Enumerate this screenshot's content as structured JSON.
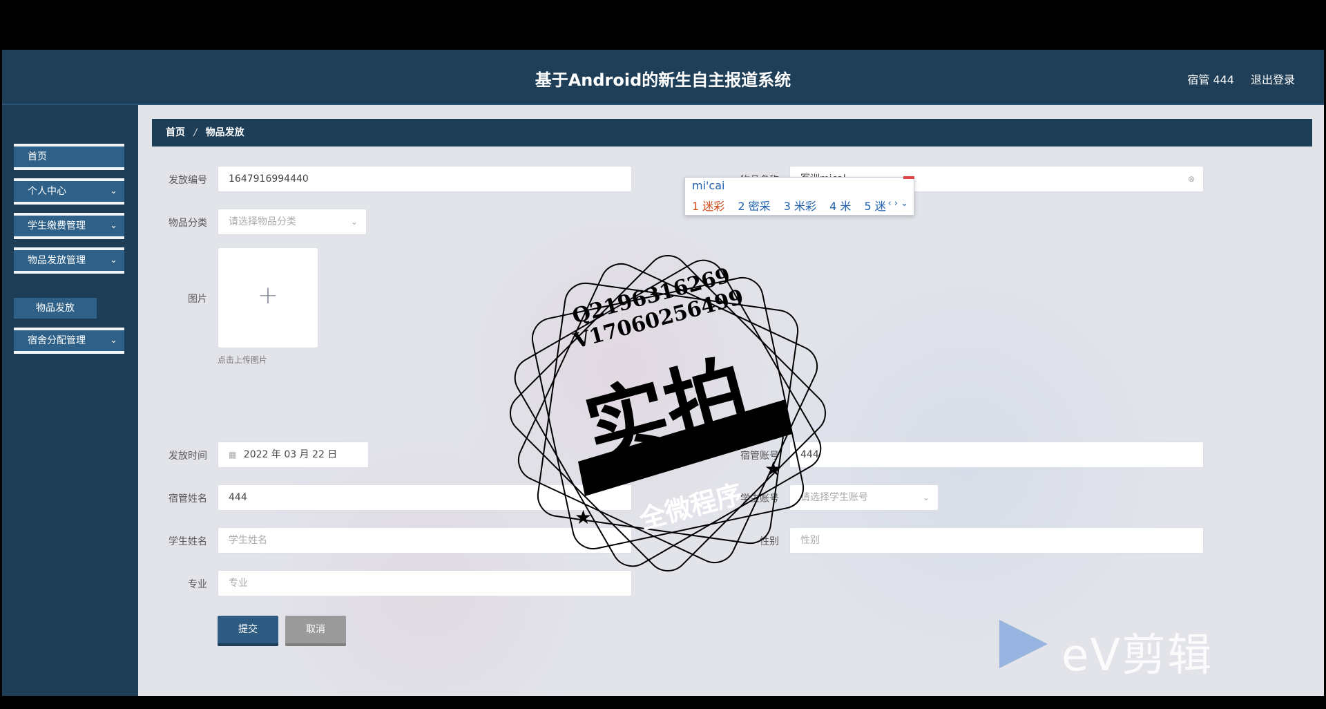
{
  "header": {
    "title": "基于Android的新生自主报道系统",
    "user": "宿管 444",
    "logout": "退出登录"
  },
  "sidebar": {
    "items": [
      {
        "label": "首页"
      },
      {
        "label": "个人中心"
      },
      {
        "label": "学生缴费管理"
      },
      {
        "label": "物品发放管理"
      },
      {
        "label": "宿舍分配管理"
      }
    ],
    "submenu": {
      "label": "物品发放"
    },
    "chevron": "chevron-down-icon"
  },
  "breadcrumb": {
    "home": "首页",
    "separator": "/",
    "current": "物品发放"
  },
  "form": {
    "fafang_bianhao": {
      "label": "发放编号",
      "value": "1647916994440"
    },
    "wupin_mingcheng": {
      "label": "物品名称",
      "value": "军训mical"
    },
    "wupin_fenlei": {
      "label": "物品分类",
      "placeholder": "请选择物品分类"
    },
    "tupian": {
      "label": "图片",
      "hint": "点击上传图片",
      "plus": "+"
    },
    "fafang_shijian": {
      "label": "发放时间",
      "value": "2022 年 03 月 22 日"
    },
    "suguan_zhanghao": {
      "label": "宿管账号",
      "value": "444"
    },
    "suguan_xingming": {
      "label": "宿管姓名",
      "value": "444"
    },
    "xuesheng_zhanghao": {
      "label": "学生账号",
      "placeholder": "请选择学生账号"
    },
    "xuesheng_xingming": {
      "label": "学生姓名",
      "placeholder": "学生姓名"
    },
    "xingbie": {
      "label": "性别",
      "placeholder": "性别"
    },
    "zhuanye": {
      "label": "专业",
      "placeholder": "专业"
    },
    "submit": "提交",
    "cancel": "取消"
  },
  "ime": {
    "pinyin": "mi'cai",
    "candidates": [
      "1 迷彩",
      "2 密采",
      "3 米彩",
      "4 米",
      "5 迷"
    ],
    "nav": "‹ › ⌄"
  },
  "watermark": {
    "line1": "Q2196316269",
    "line2": "V17060256499",
    "big": "实拍",
    "banner": "全微程序",
    "ev": "eV剪辑"
  }
}
